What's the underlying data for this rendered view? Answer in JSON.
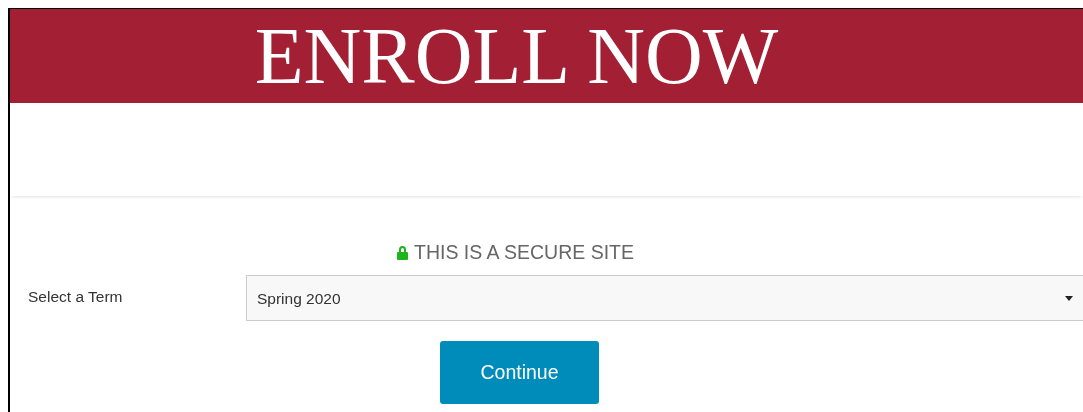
{
  "banner": {
    "title": "ENROLL NOW"
  },
  "secure_notice": {
    "text": "THIS IS A SECURE SITE"
  },
  "term_field": {
    "label": "Select a Term",
    "value": "Spring 2020"
  },
  "continue_button": {
    "label": "Continue"
  }
}
